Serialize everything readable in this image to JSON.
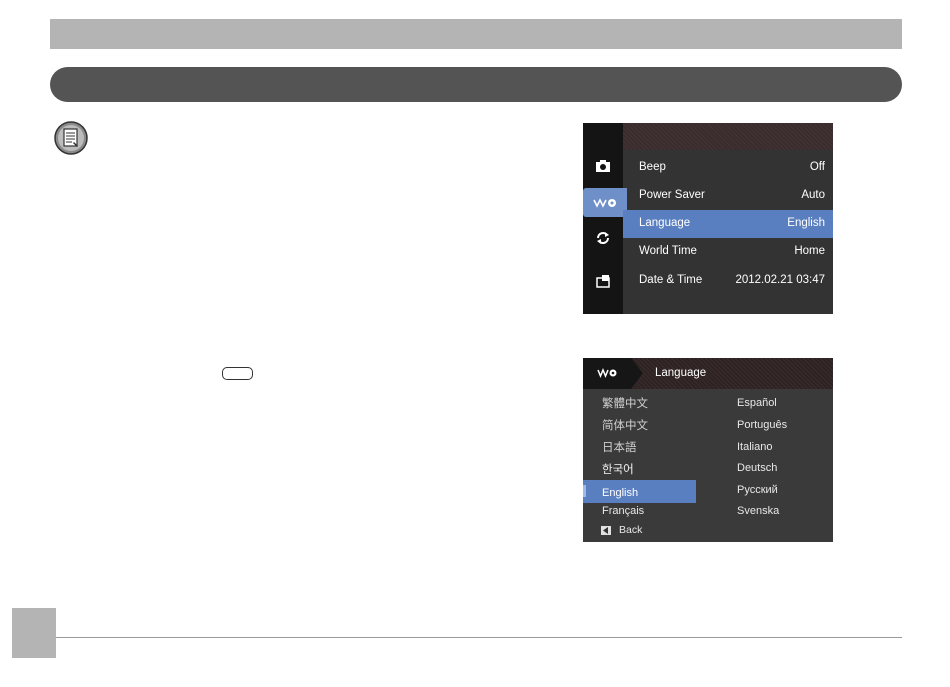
{
  "screen1": {
    "menu": [
      {
        "label": "Beep",
        "value": "Off"
      },
      {
        "label": "Power Saver",
        "value": "Auto"
      },
      {
        "label": "Language",
        "value": "English"
      },
      {
        "label": "World Time",
        "value": "Home"
      },
      {
        "label": "Date & Time",
        "value": "2012.02.21 03:47"
      }
    ],
    "selected_index": 2,
    "tabs": [
      "camera-icon",
      "settings-icon",
      "playback-icon",
      "connection-icon"
    ],
    "active_tab": 1
  },
  "screen2": {
    "title": "Language",
    "left_column": [
      "繁體中文",
      "简体中文",
      "日本語",
      "한국어",
      "English",
      "Français"
    ],
    "right_column": [
      "Español",
      "Português",
      "Italiano",
      "Deutsch",
      "Русский",
      "Svenska"
    ],
    "selected": "English",
    "back_label": "Back"
  },
  "colors": {
    "selection": "#5a7fc0",
    "pill": "#545454",
    "bar": "#b4b4b4"
  }
}
